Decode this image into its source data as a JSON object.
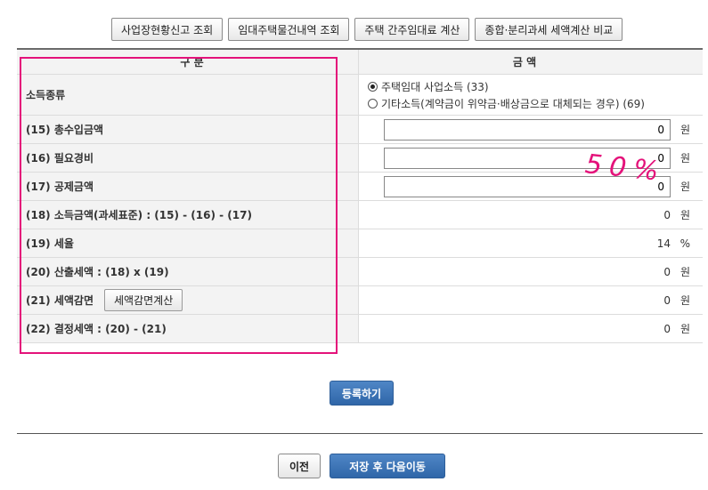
{
  "toolbar": {
    "btn1": "사업장현황신고 조회",
    "btn2": "임대주택물건내역 조회",
    "btn3": "주택 간주임대료 계산",
    "btn4": "종합·분리과세 세액계산 비교"
  },
  "table": {
    "header_label": "구 분",
    "header_amount": "금 액",
    "income_type_label": "소득종류",
    "income_option1": "주택임대 사업소득 (33)",
    "income_option2": "기타소득(계약금이 위약금·배상금으로 대체되는 경우) (69)",
    "row15_label": "(15) 총수입금액",
    "row15_value": "0",
    "row16_label": "(16) 필요경비",
    "row16_value": "0",
    "row17_label": "(17) 공제금액",
    "row17_value": "0",
    "row18_label": "(18) 소득금액(과세표준) : (15) - (16) - (17)",
    "row18_value": "0",
    "row19_label": "(19) 세율",
    "row19_value": "14",
    "row20_label": "(20) 산출세액 : (18) x (19)",
    "row20_value": "0",
    "row21_label": "(21) 세액감면",
    "row21_button": "세액감면계산",
    "row21_value": "0",
    "row22_label": "(22) 결정세액 : (20) - (21)",
    "row22_value": "0",
    "unit_won": "원",
    "unit_percent": "%"
  },
  "actions": {
    "register": "등록하기",
    "prev": "이전",
    "save_next": "저장 후 다음이동"
  },
  "annotation": {
    "handwriting": "50%",
    "color": "#e4127a"
  }
}
